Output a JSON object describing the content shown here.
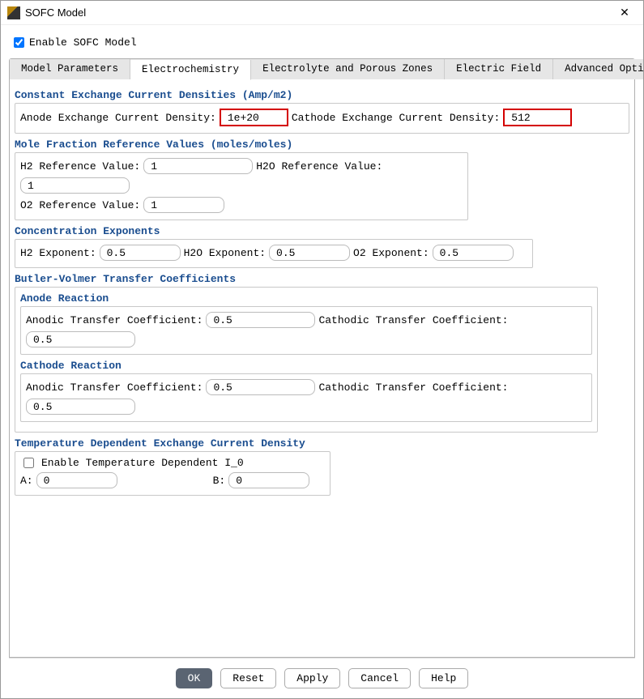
{
  "window": {
    "title": "SOFC Model"
  },
  "enable": {
    "label": "Enable SOFC Model",
    "checked": true
  },
  "tabs": {
    "t0": "Model Parameters",
    "t1": "Electrochemistry",
    "t2": "Electrolyte and Porous Zones",
    "t3": "Electric Field",
    "t4": "Advanced Options",
    "active": 1
  },
  "sections": {
    "cecd": {
      "title": "Constant Exchange Current Densities (Amp/m2)",
      "anode_label": "Anode Exchange Current Density:",
      "anode_value": "1e+20",
      "cathode_label": "Cathode Exchange Current Density:",
      "cathode_value": "512"
    },
    "mfrv": {
      "title": "Mole Fraction Reference Values (moles/moles)",
      "h2_label": "H2 Reference Value:",
      "h2_value": "1",
      "h2o_label": "H2O Reference Value:",
      "h2o_value": "1",
      "o2_label": "O2 Reference Value:",
      "o2_value": "1"
    },
    "cexp": {
      "title": "Concentration Exponents",
      "h2_label": "H2 Exponent:",
      "h2_value": "0.5",
      "h2o_label": "H2O Exponent:",
      "h2o_value": "0.5",
      "o2_label": "O2 Exponent:",
      "o2_value": "0.5"
    },
    "bv": {
      "title": "Butler-Volmer Transfer Coefficients",
      "anode_hdr": "Anode Reaction",
      "cathode_hdr": "Cathode Reaction",
      "atc_label": "Anodic Transfer Coefficient:",
      "ctc_label": "Cathodic Transfer Coefficient:",
      "anode_atc": "0.5",
      "anode_ctc": "0.5",
      "cath_atc": "0.5",
      "cath_ctc": "0.5"
    },
    "tdecd": {
      "title": "Temperature Dependent Exchange Current Density",
      "enable_label": "Enable Temperature Dependent I_0",
      "enable_checked": false,
      "a_label": "A:",
      "a_value": "0",
      "b_label": "B:",
      "b_value": "0"
    }
  },
  "buttons": {
    "ok": "OK",
    "reset": "Reset",
    "apply": "Apply",
    "cancel": "Cancel",
    "help": "Help"
  }
}
